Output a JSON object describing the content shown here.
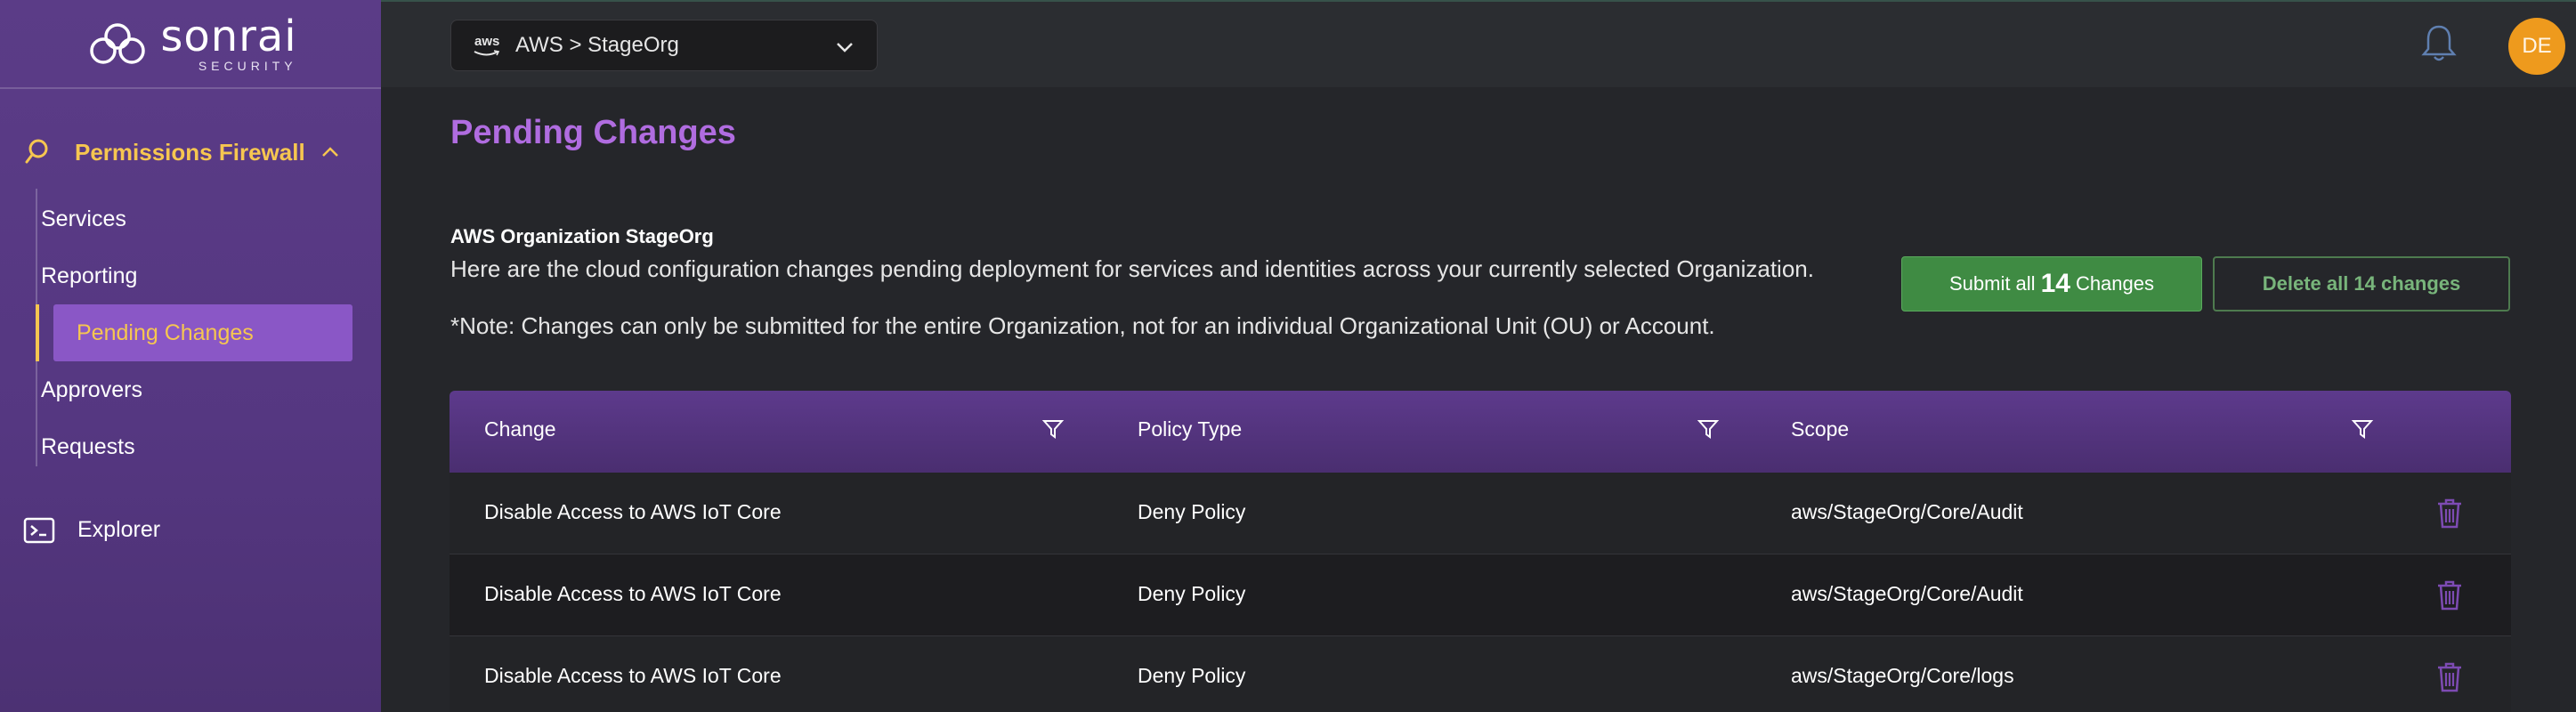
{
  "brand": {
    "name": "sonrai",
    "tagline": "SECURITY"
  },
  "sidebar": {
    "section": {
      "label": "Permissions Firewall",
      "expanded": true
    },
    "items": [
      {
        "label": "Services",
        "active": false
      },
      {
        "label": "Reporting",
        "active": false
      },
      {
        "label": "Pending Changes",
        "active": true
      },
      {
        "label": "Approvers",
        "active": false
      },
      {
        "label": "Requests",
        "active": false
      }
    ],
    "explorer": {
      "label": "Explorer"
    }
  },
  "topbar": {
    "org_selector": {
      "provider_icon": "aws",
      "label": "AWS > StageOrg"
    },
    "notifications_icon": "bell-icon",
    "avatar_initials": "DE"
  },
  "main": {
    "title": "Pending Changes",
    "org_heading": "AWS Organization StageOrg",
    "description": "Here are the cloud configuration changes pending deployment for services and identities across your currently selected Organization.",
    "note": "*Note: Changes can only be submitted for the entire Organization, not for an individual Organizational Unit (OU) or Account.",
    "submit_button": {
      "prefix": "Submit all",
      "count": "14",
      "suffix": "Changes"
    },
    "delete_button": {
      "label": "Delete all 14 changes"
    }
  },
  "table": {
    "columns": [
      "Change",
      "Policy Type",
      "Scope"
    ],
    "rows": [
      {
        "change": "Disable Access to AWS IoT Core",
        "policy_type": "Deny Policy",
        "scope": "aws/StageOrg/Core/Audit"
      },
      {
        "change": "Disable Access to AWS IoT Core",
        "policy_type": "Deny Policy",
        "scope": "aws/StageOrg/Core/Audit"
      },
      {
        "change": "Disable Access to AWS IoT Core",
        "policy_type": "Deny Policy",
        "scope": "aws/StageOrg/Core/logs"
      }
    ]
  },
  "colors": {
    "sidebar_bg": "#5b3c87",
    "accent_yellow": "#f6c650",
    "title_purple": "#b06ce0",
    "submit_green": "#3f8b43",
    "avatar_orange": "#ee9a1d",
    "trash_purple": "#7d4bb3"
  }
}
